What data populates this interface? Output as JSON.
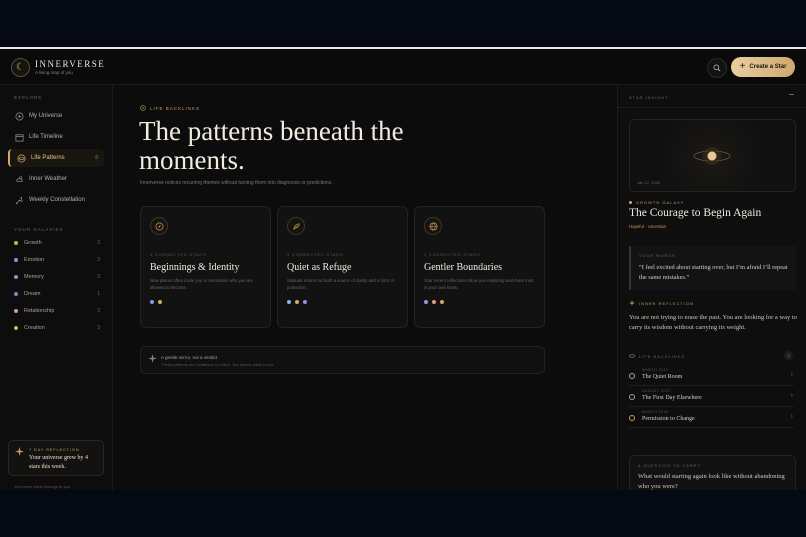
{
  "app": {
    "brand": "INNERVERSE",
    "tagline": "A living map of you",
    "create_label": "Create a Star"
  },
  "sidebar": {
    "explore_label": "EXPLORE",
    "nav": [
      {
        "label": "My Universe",
        "icon": "orbit-icon"
      },
      {
        "label": "Life Timeline",
        "icon": "calendar-icon"
      },
      {
        "label": "Life Patterns",
        "icon": "pattern-icon",
        "count": "8",
        "active": true
      },
      {
        "label": "Inner Weather",
        "icon": "weather-icon"
      },
      {
        "label": "Weekly Constellation",
        "icon": "constellation-icon"
      }
    ],
    "galaxies_label": "YOUR GALAXIES",
    "galaxies": [
      {
        "label": "Growth",
        "count": "3",
        "color": "#d4a962"
      },
      {
        "label": "Emotion",
        "count": "3",
        "color": "#7b9fe0"
      },
      {
        "label": "Memory",
        "count": "3",
        "color": "#9f86d8"
      },
      {
        "label": "Dream",
        "count": "1",
        "color": "#8a7fd0"
      },
      {
        "label": "Relationship",
        "count": "3",
        "color": "#d89a8a"
      },
      {
        "label": "Creation",
        "count": "3",
        "color": "#c9b36a"
      }
    ],
    "reflection": {
      "label": "7 DAY REFLECTION",
      "text": "Your universe grew by 4 stars this week."
    },
    "footer": "Your inner world belongs to you"
  },
  "main": {
    "eyebrow": "LIFE BACKLINKS",
    "title": "The patterns beneath the moments.",
    "lead": "Innerverse notices recurring themes without turning them into diagnoses or predictions.",
    "cards": [
      {
        "kicker": "4 CONNECTED STARS",
        "title": "Beginnings & Identity",
        "desc": "New places often invite you to reconsider who you are allowed to become.",
        "icon": "compass-icon",
        "dots": [
          "#7b9fe0",
          "#d4a962"
        ]
      },
      {
        "kicker": "3 CONNECTED STARS",
        "title": "Quiet as Refuge",
        "desc": "Solitude returns as both a source of clarity and a form of protection.",
        "icon": "feather-icon",
        "dots": [
          "#7bc0d8",
          "#d4a962",
          "#9f86d8"
        ]
      },
      {
        "kicker": "3 CONNECTED STARS",
        "title": "Gentler Boundaries",
        "desc": "Your recent reflections show you exploring and more trust in your own limits.",
        "icon": "globe-icon",
        "dots": [
          "#b48ad8",
          "#d89a8a",
          "#d4a962"
        ]
      }
    ],
    "mirror": {
      "title": "A gentle mirror, not a verdict",
      "text": "These patterns are invitations to reflect. You decide what is true."
    }
  },
  "panel": {
    "section": "STAR INSIGHT",
    "date": "Jan 12, 2026",
    "galaxy": "GROWTH GALAXY",
    "title": "The Courage to Begin Again",
    "tags": "Hopeful · Uncertain",
    "words_label": "YOUR WORDS",
    "quote": "“I feel excited about starting over, but I’m afraid I’ll repeat the same mistakes.”",
    "reflection_label": "INNER REFLECTION",
    "reflection": "You are not trying to erase the past. You are looking for a way to carry its wisdom without carrying its weight.",
    "backlinks_label": "LIFE BACKLINKS",
    "backlinks_count": "3",
    "backlinks": [
      {
        "kicker": "MARCH 2019",
        "title": "The Quiet Room"
      },
      {
        "kicker": "AUGUST 2022",
        "title": "The First Day Elsewhere"
      },
      {
        "kicker": "MARCH 2025",
        "title": "Permission to Change"
      }
    ],
    "question_label": "A QUESTION TO CARRY",
    "question": "What would starting again look like without abandoning who you were?"
  }
}
